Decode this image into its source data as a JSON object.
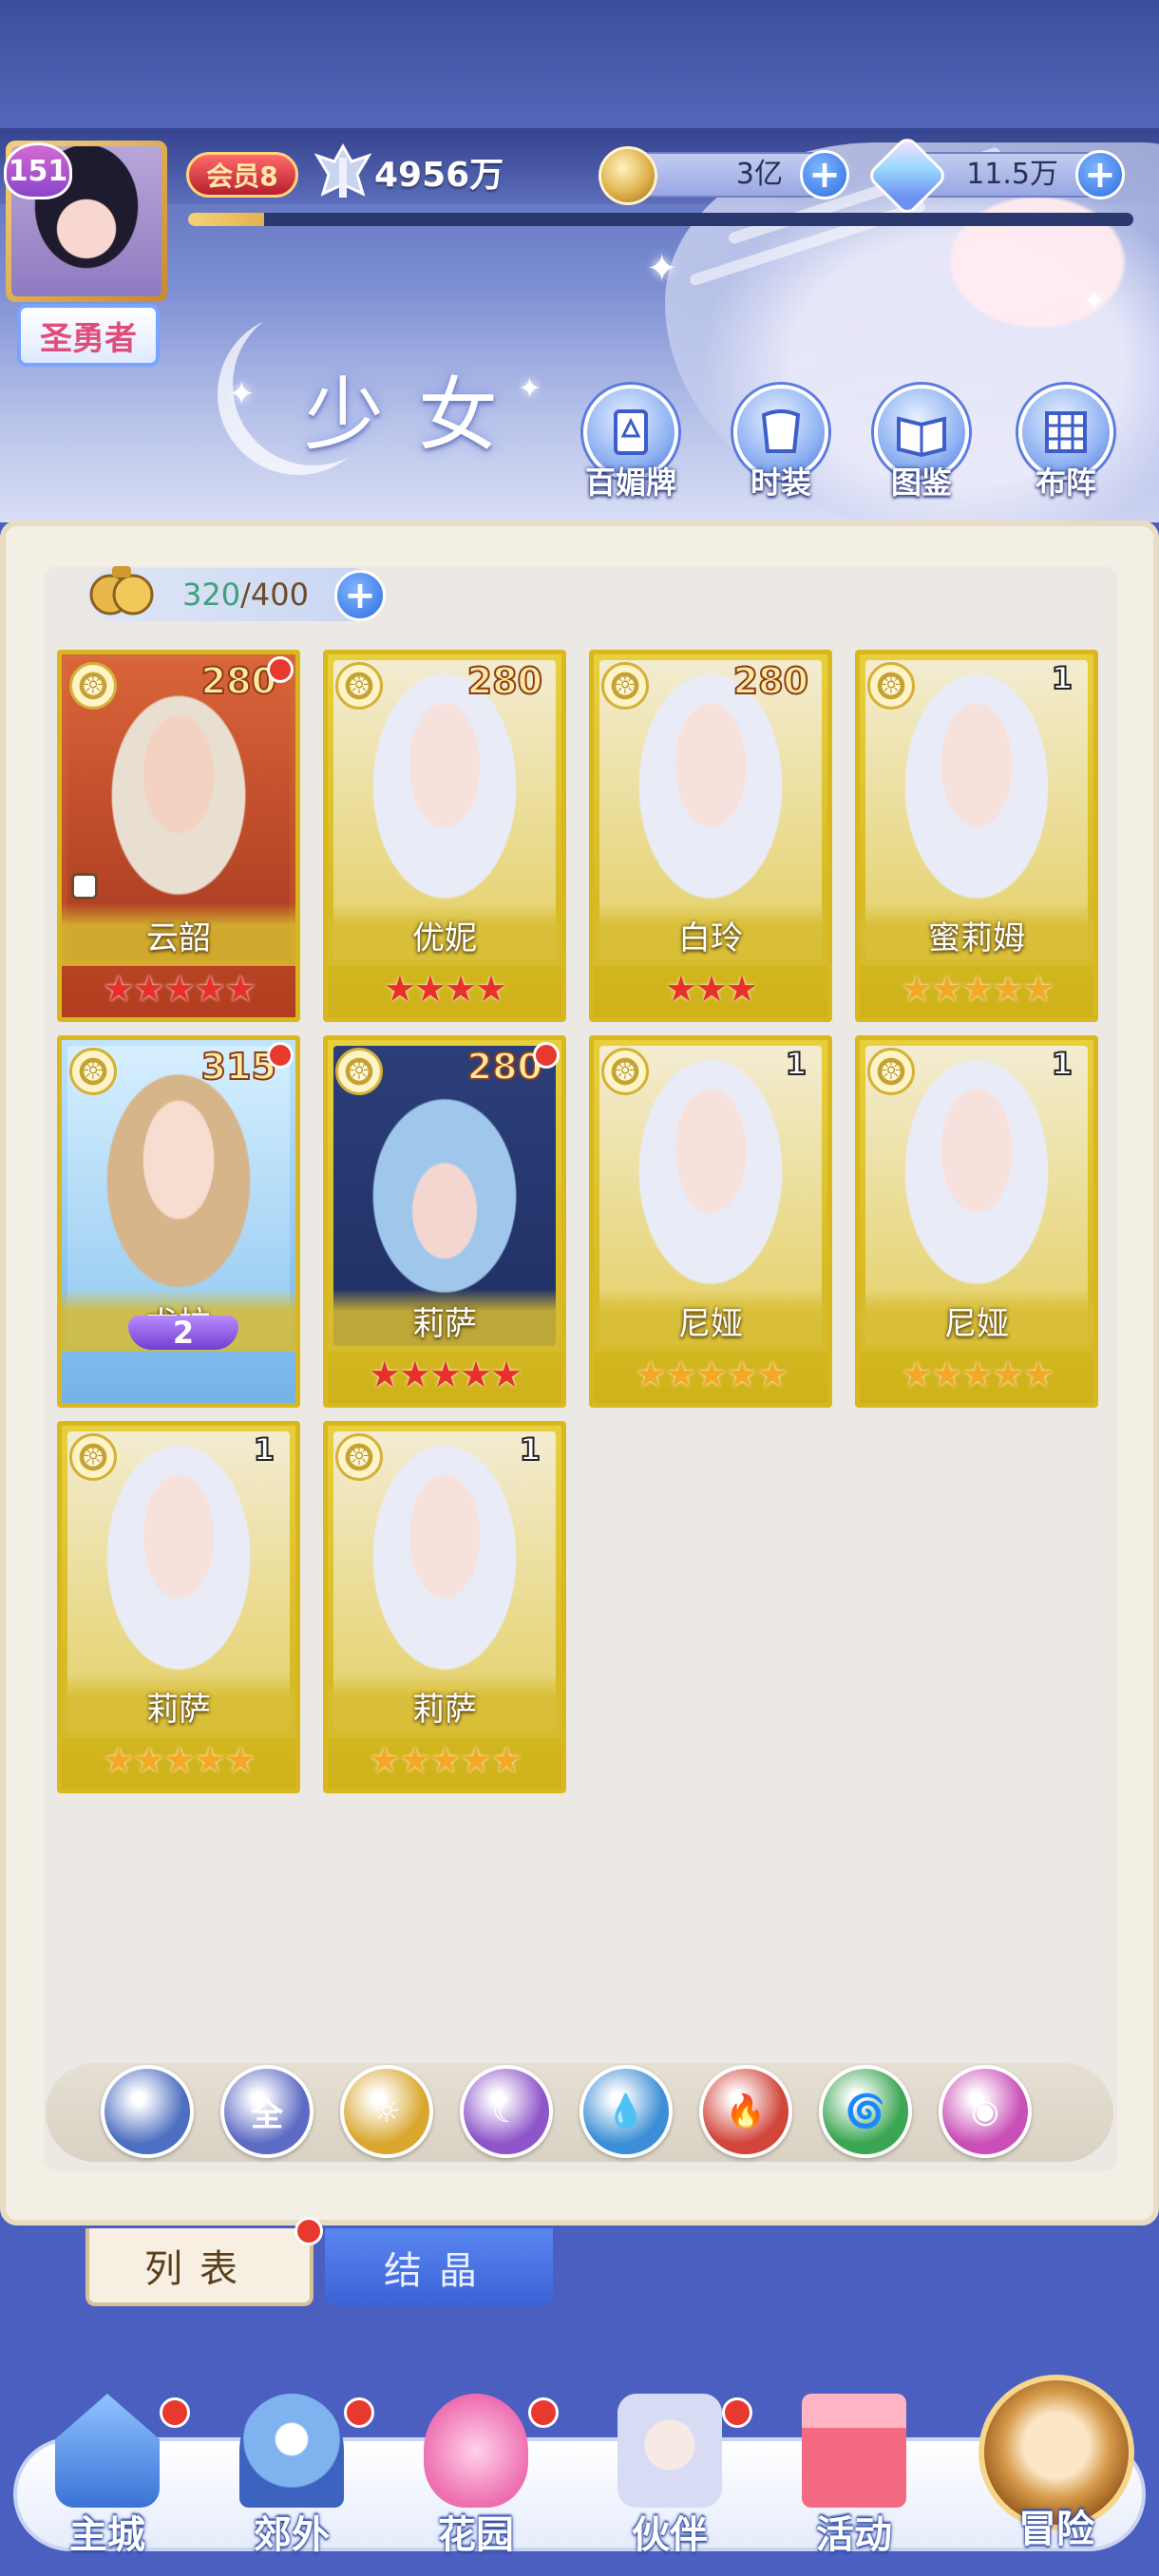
{
  "player": {
    "level": "151",
    "title": "圣勇者",
    "vip": "会员8",
    "power": "4956万",
    "exp_progress": 0.08
  },
  "currencies": [
    {
      "icon": "gold-coin-icon",
      "value": "3亿"
    },
    {
      "icon": "diamond-gem-icon",
      "value": "11.5万"
    }
  ],
  "page": {
    "title": "少女"
  },
  "menu": [
    {
      "id": "cards",
      "label": "百媚牌",
      "icon": "card-icon"
    },
    {
      "id": "costume",
      "label": "时装",
      "icon": "costume-icon"
    },
    {
      "id": "codex",
      "label": "图鉴",
      "icon": "book-icon"
    },
    {
      "id": "formation",
      "label": "布阵",
      "icon": "grid-icon"
    }
  ],
  "capacity": {
    "current": "320",
    "max": "/400"
  },
  "characters": [
    {
      "name": "云韶",
      "level": "280",
      "stars": "★★★★★",
      "star_color": "red",
      "bg": "red",
      "dot": true,
      "lock": true
    },
    {
      "name": "优妮",
      "level": "280",
      "stars": "★★★★",
      "star_color": "red",
      "bg": "gold",
      "dot": false
    },
    {
      "name": "白玲",
      "level": "280",
      "stars": "★★★",
      "star_color": "red",
      "bg": "gold",
      "dot": false
    },
    {
      "name": "蜜莉姆",
      "level": "1",
      "stars": "★★★★★",
      "star_color": "gold",
      "bg": "gold",
      "dot": false
    },
    {
      "name": "尤拉",
      "level": "315",
      "stars": "",
      "star_color": "gold",
      "bg": "blue",
      "dot": true,
      "awaken": "2"
    },
    {
      "name": "莉萨",
      "level": "280",
      "stars": "★★★★★",
      "star_color": "red",
      "bg": "dark",
      "dot": true
    },
    {
      "name": "尼娅",
      "level": "1",
      "stars": "★★★★★",
      "star_color": "gold",
      "bg": "gold",
      "dot": false
    },
    {
      "name": "尼娅",
      "level": "1",
      "stars": "★★★★★",
      "star_color": "gold",
      "bg": "gold",
      "dot": false
    },
    {
      "name": "莉萨",
      "level": "1",
      "stars": "★★★★★",
      "star_color": "gold",
      "bg": "gold",
      "dot": false
    },
    {
      "name": "莉萨",
      "level": "1",
      "stars": "★★★★★",
      "star_color": "gold",
      "bg": "gold",
      "dot": false
    }
  ],
  "filters": [
    {
      "id": "wind",
      "icon": "wind-rank-icon",
      "text": "",
      "color": "#4d6fc1"
    },
    {
      "id": "all",
      "icon": "all-icon",
      "text": "全",
      "color": "#5e6bc4"
    },
    {
      "id": "light",
      "icon": "sun-icon",
      "text": "☼",
      "color": "#d9a72f"
    },
    {
      "id": "dark",
      "icon": "moon-icon",
      "text": "☾",
      "color": "#8e55c9"
    },
    {
      "id": "water",
      "icon": "water-drop-icon",
      "text": "💧",
      "color": "#3c8fd6"
    },
    {
      "id": "fire",
      "icon": "fire-icon",
      "text": "🔥",
      "color": "#d1453a"
    },
    {
      "id": "wind2",
      "icon": "tornado-icon",
      "text": "🌀",
      "color": "#3aa552"
    },
    {
      "id": "spirit",
      "icon": "spirit-icon",
      "text": "◉",
      "color": "#c94fb7"
    }
  ],
  "tabs": {
    "list": "列表",
    "crystal": "结晶"
  },
  "nav": [
    {
      "label": "主城",
      "icon": "castle-icon"
    },
    {
      "label": "郊外",
      "icon": "gate-icon"
    },
    {
      "label": "花园",
      "icon": "heart-garden-icon"
    },
    {
      "label": "伙伴",
      "icon": "partner-icon"
    },
    {
      "label": "活动",
      "icon": "gift-icon"
    },
    {
      "label": "冒险",
      "icon": "compass-icon"
    }
  ],
  "colors": {
    "accent_blue": "#2f6fe0",
    "notify_red": "#e8392e",
    "card_gold": "#d8b81e"
  }
}
